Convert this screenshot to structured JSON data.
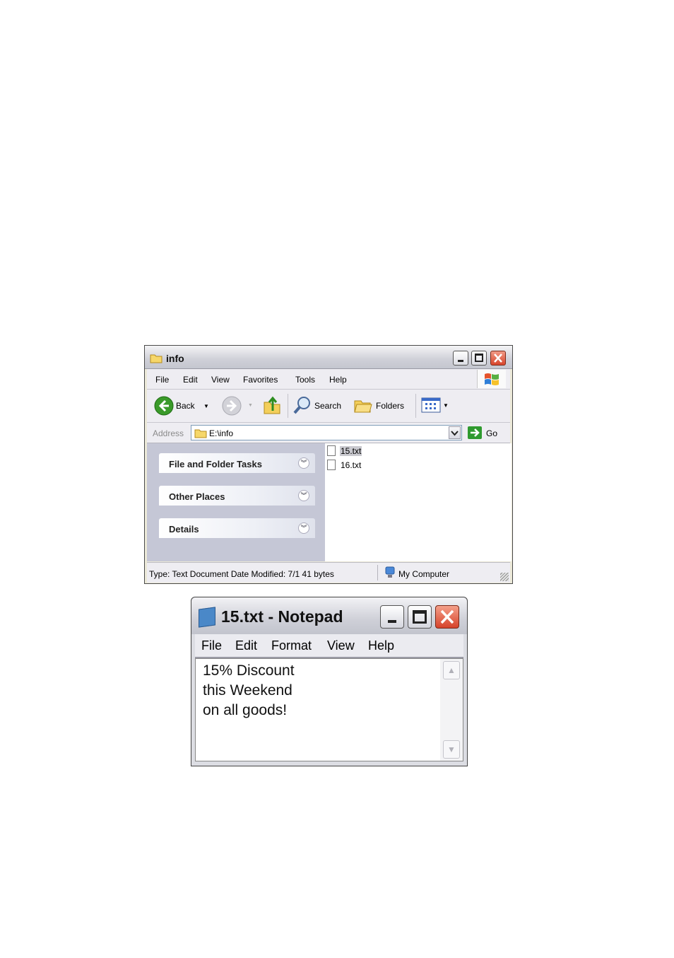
{
  "explorer": {
    "title": "info",
    "menu": [
      "File",
      "Edit",
      "View",
      "Favorites",
      "Tools",
      "Help"
    ],
    "toolbar": {
      "back": "Back",
      "search": "Search",
      "folders": "Folders"
    },
    "address": {
      "label": "Address",
      "path": "E:\\info",
      "go": "Go"
    },
    "tasks": [
      "File and Folder Tasks",
      "Other Places",
      "Details"
    ],
    "files": [
      {
        "name": "15.txt",
        "selected": true
      },
      {
        "name": "16.txt",
        "selected": false
      }
    ],
    "status": {
      "info": "Type: Text Document Date Modified: 7/1 41 bytes",
      "location": "My Computer"
    }
  },
  "notepad": {
    "title": "15.txt - Notepad",
    "menu": [
      "File",
      "Edit",
      "Format",
      "View",
      "Help"
    ],
    "lines": [
      "15% Discount",
      "this Weekend",
      "on all goods!"
    ]
  }
}
